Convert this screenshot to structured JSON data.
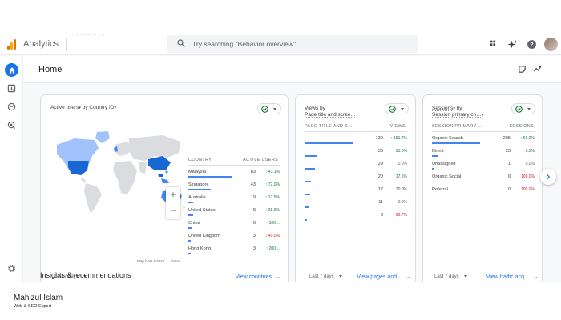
{
  "app": {
    "title": "Analytics",
    "property_label": "˙ ˙˙˙ ˙˙˙˙ ˙˙˙ ˙˙"
  },
  "search": {
    "placeholder": "Try searching \"Behavior overview\""
  },
  "icons": {
    "apps": "apps-grid-icon",
    "sparkle": "sparkle-icon",
    "help": "help-icon",
    "home": "home-icon",
    "reports": "reports-icon",
    "explore": "explore-icon",
    "advertising": "advertising-icon",
    "settings": "gear-icon"
  },
  "colors": {
    "accent": "#1a73e8",
    "bar": "#4285f4",
    "positive": "#137333",
    "negative": "#c5221f",
    "map_land": "#dadce0",
    "map_high": "#1967d2",
    "map_mid": "#4285f4",
    "map_low": "#a1c2fa"
  },
  "home": {
    "title": "Home"
  },
  "cards": [
    {
      "title_parts": [
        "Active users",
        " by ",
        "Country ID"
      ],
      "columns": [
        "COUNTRY",
        "ACTIVE USERS"
      ],
      "rows": [
        {
          "label": "Malaysia",
          "value": "83",
          "change": "↑ 43.1%",
          "dir": "up",
          "share": 1.0
        },
        {
          "label": "Singapore",
          "value": "43",
          "change": "↑ 72.0%",
          "dir": "up",
          "share": 0.52
        },
        {
          "label": "Australia",
          "value": "9",
          "change": "↑ 12.5%",
          "dir": "up",
          "share": 0.11
        },
        {
          "label": "United States",
          "value": "9",
          "change": "↑ 28.6%",
          "dir": "up",
          "share": 0.11
        },
        {
          "label": "China",
          "value": "6",
          "change": "↑ 100…",
          "dir": "up",
          "share": 0.07
        },
        {
          "label": "United Kingdom",
          "value": "3",
          "change": "↓ 40.0%",
          "dir": "down",
          "share": 0.04
        },
        {
          "label": "Hong Kong",
          "value": "3",
          "change": "↑ 200…",
          "dir": "up",
          "share": 0.04
        }
      ],
      "map_attribution": [
        "Map Data ©2026",
        "Terms"
      ],
      "zoom": [
        "+",
        "−"
      ],
      "range": "Last 7 days",
      "link": "View countries"
    },
    {
      "title_parts": [
        "Views by",
        "Page title and scree…"
      ],
      "columns": [
        "PAGE TITLE AND S…",
        "VIEWS"
      ],
      "rows": [
        {
          "value": "139",
          "change": "↑ 151.7%",
          "dir": "up",
          "share": 1.0
        },
        {
          "value": "38",
          "change": "↑ 31.0%",
          "dir": "up",
          "share": 0.27
        },
        {
          "value": "29",
          "change": "0.0%",
          "dir": "flat",
          "share": 0.21
        },
        {
          "value": "20",
          "change": "↑ 17.6%",
          "dir": "up",
          "share": 0.14
        },
        {
          "value": "17",
          "change": "↑ 70.0%",
          "dir": "up",
          "share": 0.12
        },
        {
          "value": "11",
          "change": "0.0%",
          "dir": "flat",
          "share": 0.08
        },
        {
          "value": "3",
          "change": "↓ 66.7%",
          "dir": "down",
          "share": 0.02
        }
      ],
      "range": "Last 7 days",
      "link": "View pages and…"
    },
    {
      "title_parts": [
        "Sessions",
        " by",
        "Session primary ch…"
      ],
      "columns": [
        "SESSION PRIMARY …",
        "SESSIONS"
      ],
      "rows": [
        {
          "label": "Organic Search",
          "value": "205",
          "change": "↑ 60.2%",
          "dir": "up",
          "share": 1.0
        },
        {
          "label": "Direct",
          "value": "23",
          "change": "↑ 9.5%",
          "dir": "up",
          "share": 0.11
        },
        {
          "label": "Unassigned",
          "value": "1",
          "change": "0.0%",
          "dir": "flat",
          "share": 0.005
        },
        {
          "label": "Organic Social",
          "value": "0",
          "change": "↓ 100.0%",
          "dir": "down",
          "share": 0
        },
        {
          "label": "Referral",
          "value": "0",
          "change": "↓ 100.0%",
          "dir": "down",
          "share": 0
        }
      ],
      "range": "Last 7 days",
      "link": "View traffic acq…"
    }
  ],
  "insights": {
    "title": "Insights & recommendations"
  },
  "footer": {
    "name": "Mahizul Islam",
    "subtitle": "Web & SEO Expert"
  }
}
